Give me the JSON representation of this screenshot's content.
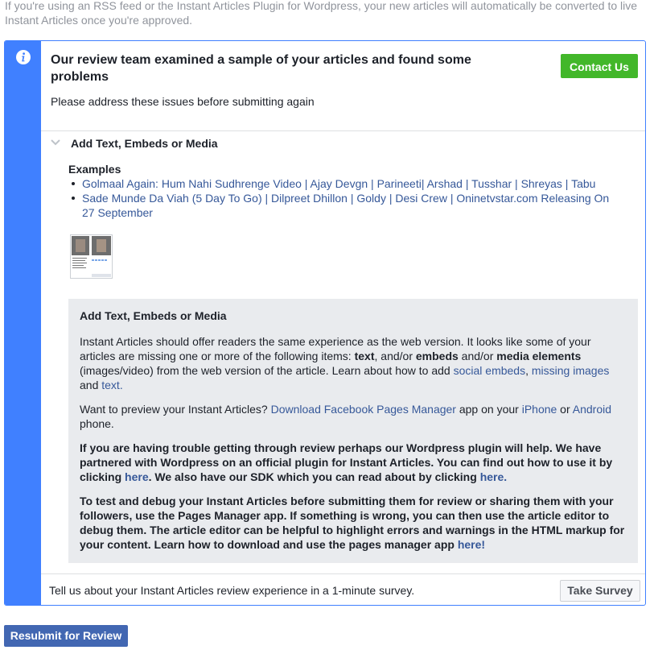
{
  "intro_text": "If you're using an RSS feed or the Instant Articles Plugin for Wordpress, your new articles will automatically be converted to live Instant Articles once you're approved.",
  "colors": {
    "accent": "#4080ff",
    "contact": "#42b72a",
    "resubmit": "#4267b2",
    "link": "#365899"
  },
  "review": {
    "icon": "info-icon",
    "title": "Our review team examined a sample of your articles and found some problems",
    "subtitle": "Please address these issues before submitting again",
    "contact_label": "Contact Us"
  },
  "issue": {
    "icon": "chevron-down-icon",
    "title": "Add Text, Embeds or Media",
    "examples_label": "Examples",
    "examples": [
      "Golmaal Again: Hum Nahi Sudhrenge Video | Ajay Devgn | Parineeti| Arshad | Tusshar | Shreyas | Tabu",
      "Sade Munde Da Viah (5 Day To Go) | Dilpreet Dhillon | Goldy | Desi Crew | Oninetvstar.com Releasing On 27 September"
    ]
  },
  "guide": {
    "title": "Add Text, Embeds or Media",
    "p1": {
      "t1": "Instant Articles should offer readers the same experience as the web version. It looks like some of your articles are missing one or more of the following items: ",
      "b1": "text",
      "t2": ", and/or ",
      "b2": "embeds",
      "t3": " and/or ",
      "b3": "media elements",
      "t4": " (images/video) from the web version of the article. Learn about how to add ",
      "l1": "social embeds",
      "t5": ", ",
      "l2": "missing images",
      "t6": " and ",
      "l3": "text."
    },
    "p2": {
      "t1": "Want to preview your Instant Articles? ",
      "l1": "Download Facebook Pages Manager",
      "t2": " app on your ",
      "l2": "iPhone",
      "t3": " or ",
      "l3": "Android",
      "t4": " phone."
    },
    "p3": {
      "t1": "If you are having trouble getting through review perhaps our Wordpress plugin will help. We have partnered with Wordpress on an official plugin for Instant Articles. You can find out how to use it by clicking ",
      "l1": "here",
      "t2": ". We also have our SDK which you can read about by clicking ",
      "l2": "here."
    },
    "p4": {
      "t1": "To test and debug your Instant Articles before submitting them for review or sharing them with your followers, use the Pages Manager app. If something is wrong, you can then use the article editor to debug them. The article editor can be helpful to highlight errors and warnings in the HTML markup for your content. Learn how to download and use the pages manager app ",
      "l1": "here!"
    }
  },
  "survey": {
    "text": "Tell us about your Instant Articles review experience in a 1-minute survey.",
    "button": "Take Survey"
  },
  "resubmit_label": "Resubmit for Review"
}
